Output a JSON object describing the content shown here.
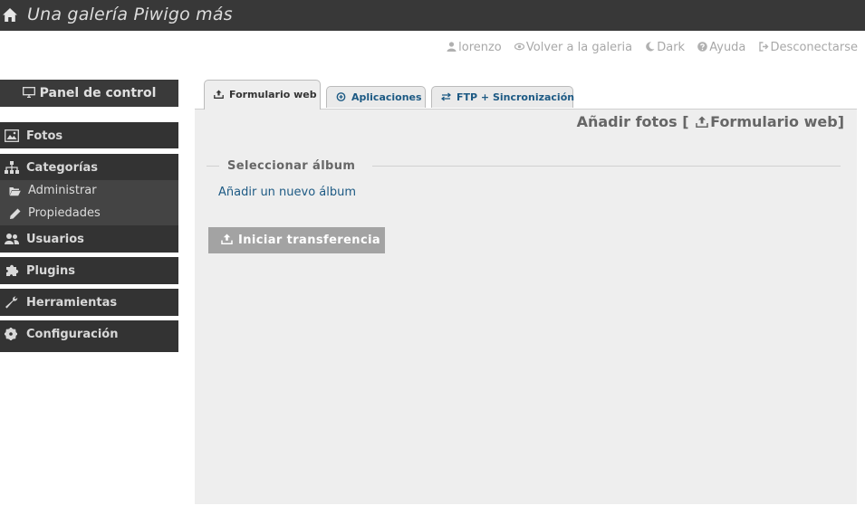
{
  "header": {
    "title": "Una galería Piwigo más"
  },
  "userbar": {
    "user": "lorenzo",
    "back_to_gallery": "Volver a la galeria",
    "theme": "Dark",
    "help": "Ayuda",
    "logout": "Desconectarse"
  },
  "sidebar": {
    "panel_title": "Panel de control",
    "items": [
      {
        "label": "Fotos",
        "icon": "image-icon"
      },
      {
        "label": "Categorías",
        "icon": "sitemap-icon"
      },
      {
        "label": "Usuarios",
        "icon": "users-icon"
      },
      {
        "label": "Plugins",
        "icon": "puzzle-icon"
      },
      {
        "label": "Herramientas",
        "icon": "wrench-icon"
      },
      {
        "label": "Configuración",
        "icon": "gear-icon"
      }
    ],
    "category_submenu": [
      {
        "label": "Administrar",
        "icon": "folder-open-icon"
      },
      {
        "label": "Propiedades",
        "icon": "pencil-icon"
      }
    ]
  },
  "tabs": [
    {
      "label": "Formulario web",
      "icon": "upload-icon",
      "active": true
    },
    {
      "label": "Aplicaciones",
      "icon": "app-icon",
      "active": false
    },
    {
      "label": "FTP + Sincronización",
      "icon": "swap-icon",
      "active": false
    }
  ],
  "main": {
    "page_title_prefix": "Añadir fotos [",
    "page_title_section": "Formulario web",
    "page_title_suffix": "]",
    "album_legend": "Seleccionar álbum",
    "add_album_link": "Añadir un nuevo álbum",
    "start_button": "Iniciar transferencia"
  },
  "colors": {
    "topbar": "#383838",
    "sidebar": "#333333",
    "submenu": "#444444",
    "content_bg": "#eeeeee",
    "link": "#1d5a84",
    "button": "#a3a3a3"
  }
}
